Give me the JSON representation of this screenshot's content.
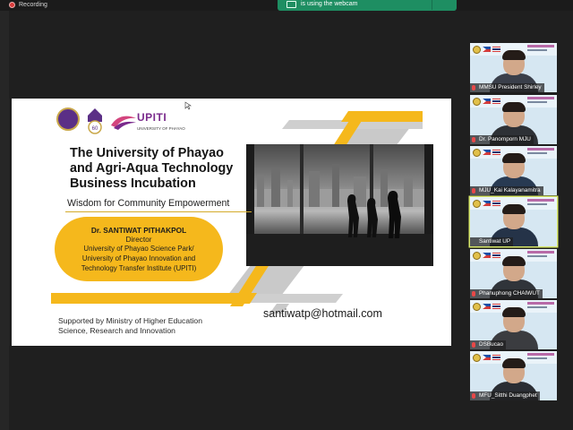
{
  "recording": {
    "label": "Recording",
    "color": "#d93b3b"
  },
  "notification": {
    "text": "is using the webcam",
    "color": "#1e8e62"
  },
  "slide": {
    "logo_text": "UPITI",
    "logo_subtext": "UNIVERSITY OF PHAYAO",
    "seal_caption": "60",
    "title_lines": [
      "The University of Phayao",
      "and Agri-Aqua Technology",
      "Business Incubation"
    ],
    "subtitle": "Wisdom for Community Empowerment",
    "presenter": {
      "name": "Dr. SANTIWAT PITHAKPOL",
      "role": "Director",
      "affiliation_lines": [
        "University of Phayao Science Park/",
        "University of Phayao Innovation and",
        "Technology Transfer Institute (UPITI)"
      ]
    },
    "email": "santiwatp@hotmail.com",
    "support_lines": [
      "Supported by Ministry of Higher Education",
      "Science, Research and Innovation"
    ],
    "accent_colors": {
      "yellow": "#f5b81c",
      "purple": "#7a2a8c"
    }
  },
  "participants": [
    {
      "name": "MMSU President Shirley",
      "muted": true,
      "active": false
    },
    {
      "name": "Dr. Panomporn MJU",
      "muted": true,
      "active": false
    },
    {
      "name": "MJU_Kai Kalayanamitra",
      "muted": true,
      "active": false
    },
    {
      "name": "Santiwat UP",
      "muted": false,
      "active": true
    },
    {
      "name": "Phanuphong CHAIWUT",
      "muted": true,
      "active": false
    },
    {
      "name": "DSBucao",
      "muted": true,
      "active": false
    },
    {
      "name": "MFU_Sitthi Duangphet",
      "muted": true,
      "active": false
    }
  ]
}
